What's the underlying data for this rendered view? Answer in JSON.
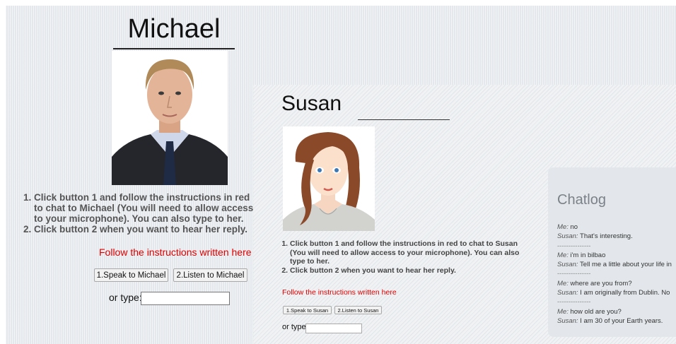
{
  "michael": {
    "name": "Michael",
    "instructions": [
      "Click button 1 and follow the instructions in red to chat to Michael (You will need to allow access to your microphone). You can also type to her.",
      "Click button 2 when you want to hear her reply."
    ],
    "red_note": "Follow the instructions written here",
    "speak_button": "1.Speak to Michael",
    "listen_button": "2.Listen to Michael",
    "type_label": "or type:",
    "type_value": ""
  },
  "susan": {
    "name": "Susan",
    "instructions": [
      "Click button 1 and follow the instructions in red to chat to Susan (You will need to allow access to your microphone). You can also type to her.",
      "Click button 2 when you want to hear her reply."
    ],
    "red_note": "Follow the instructions written here",
    "speak_button": "1.Speak to Susan",
    "listen_button": "2.Listen to Susan",
    "type_label": "or type:",
    "type_value": ""
  },
  "chatlog": {
    "title": "Chatlog",
    "separator": "---------------",
    "entries": [
      {
        "speaker": "Me:",
        "text": "no"
      },
      {
        "speaker": "Susan:",
        "text": "That's interesting."
      },
      {
        "speaker": "Me:",
        "text": "i'm in bilbao"
      },
      {
        "speaker": "Susan:",
        "text": "Tell me a little about your life in"
      },
      {
        "speaker": "Me:",
        "text": "where are you from?"
      },
      {
        "speaker": "Susan:",
        "text": "I am originally from Dublin. No"
      },
      {
        "speaker": "Me:",
        "text": "how old are you?"
      },
      {
        "speaker": "Susan:",
        "text": "I am 30 of your Earth years."
      }
    ]
  },
  "colors": {
    "instruction_red": "#e00000",
    "michael_bg": "#e4e8ec",
    "susan_bg": "#f0f2f4",
    "chatlog_bg": "#e3e7eb"
  }
}
